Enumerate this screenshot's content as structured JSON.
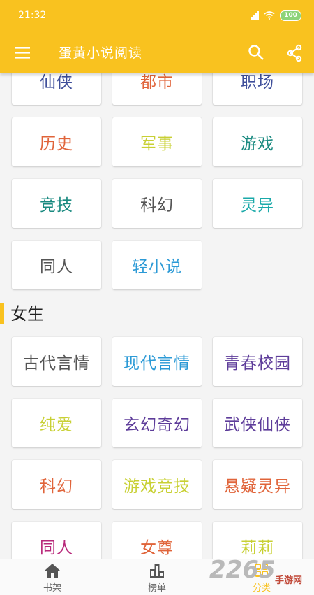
{
  "status_bar": {
    "time": "21:32",
    "battery": "100"
  },
  "toolbar": {
    "title": "蛋黄小说阅读",
    "menu_icon": "menu-icon",
    "search_icon": "search-icon",
    "share_icon": "share-icon"
  },
  "male_categories": [
    {
      "label": "仙侠",
      "color": "#3e4e9a"
    },
    {
      "label": "都市",
      "color": "#e0643a"
    },
    {
      "label": "职场",
      "color": "#3e4e9a"
    },
    {
      "label": "历史",
      "color": "#e0643a"
    },
    {
      "label": "军事",
      "color": "#c8d034"
    },
    {
      "label": "游戏",
      "color": "#1a8a80"
    },
    {
      "label": "竞技",
      "color": "#1a8a80"
    },
    {
      "label": "科幻",
      "color": "#555555"
    },
    {
      "label": "灵异",
      "color": "#1aa9a9"
    },
    {
      "label": "同人",
      "color": "#555555"
    },
    {
      "label": "轻小说",
      "color": "#2c9ad6"
    }
  ],
  "female_section": {
    "title": "女生"
  },
  "female_categories": [
    {
      "label": "古代言情",
      "color": "#555555"
    },
    {
      "label": "现代言情",
      "color": "#2c9ad6"
    },
    {
      "label": "青春校园",
      "color": "#5e3d9a"
    },
    {
      "label": "纯爱",
      "color": "#c8d034"
    },
    {
      "label": "玄幻奇幻",
      "color": "#5e3d9a"
    },
    {
      "label": "武侠仙侠",
      "color": "#5e3d9a"
    },
    {
      "label": "科幻",
      "color": "#e0643a"
    },
    {
      "label": "游戏竞技",
      "color": "#c8d034"
    },
    {
      "label": "悬疑灵异",
      "color": "#e0643a"
    },
    {
      "label": "同人",
      "color": "#b8287a"
    },
    {
      "label": "女尊",
      "color": "#e0643a"
    },
    {
      "label": "莉莉",
      "color": "#c8d034"
    }
  ],
  "bottom_nav": [
    {
      "label": "书架",
      "icon": "home-icon"
    },
    {
      "label": "榜单",
      "icon": "chart-icon"
    },
    {
      "label": "分类",
      "icon": "category-icon",
      "active": true
    }
  ],
  "watermark": {
    "number": "2265",
    "text": "手游网"
  },
  "accent_color": "#f9c21f"
}
